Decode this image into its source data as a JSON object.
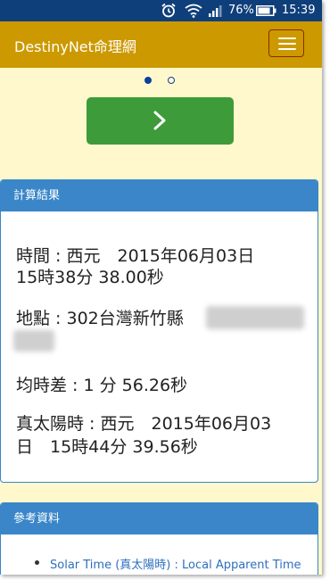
{
  "status_bar": {
    "battery_percent": "76%",
    "time": "15:39",
    "icons": [
      "alarm-icon",
      "wifi-icon",
      "signal-icon",
      "battery-icon"
    ]
  },
  "navbar": {
    "brand": "DestinyNet命理網",
    "menu_icon": "hamburger-menu-icon"
  },
  "carousel": {
    "slide_count": 2,
    "active_index": 0,
    "next_icon": "chevron-right-icon"
  },
  "result_panel": {
    "title": "計算結果",
    "time_line1": "時間 : 西元　2015年06月03日",
    "time_line2": "15時38分 38.00秒",
    "location_line": "地點 : 302台灣新竹縣",
    "equation_line": "均時差 : 1 分 56.26秒",
    "solar_line1": "真太陽時 : 西元　2015年06月03",
    "solar_line2": "日　15時44分 39.56秒"
  },
  "reference_panel": {
    "title": "參考資料",
    "links": [
      "Solar Time (真太陽時) : Local Apparent Time"
    ]
  },
  "colors": {
    "status_bar": "#0f3f7a",
    "navbar": "#cc9900",
    "page_bg": "#fff8cc",
    "next_button": "#3e9b3a",
    "panel_heading": "#3a86c8",
    "link": "#2e6fbd"
  }
}
